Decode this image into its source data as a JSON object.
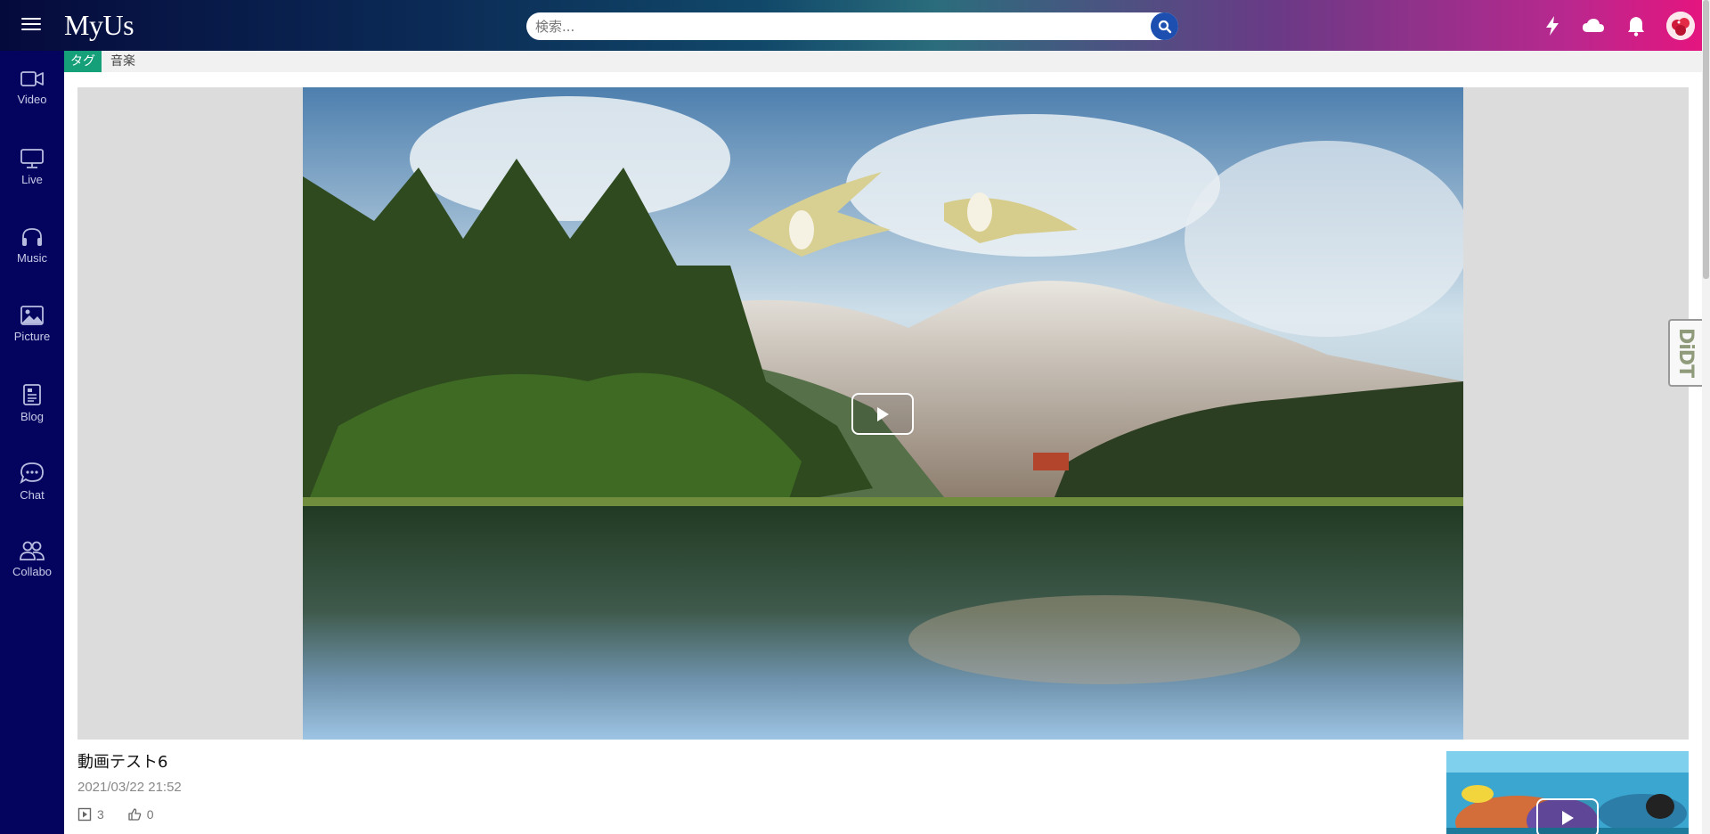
{
  "app": {
    "logo_text": "MyUs"
  },
  "header": {
    "search_placeholder": "検索...",
    "icons": [
      "lightning-icon",
      "cloud-icon",
      "bell-icon"
    ]
  },
  "sidebar": {
    "items": [
      {
        "label": "Video",
        "icon": "video-camera-icon"
      },
      {
        "label": "Live",
        "icon": "monitor-icon"
      },
      {
        "label": "Music",
        "icon": "headphones-icon"
      },
      {
        "label": "Picture",
        "icon": "image-icon"
      },
      {
        "label": "Blog",
        "icon": "document-icon"
      },
      {
        "label": "Chat",
        "icon": "chat-bubble-icon"
      },
      {
        "label": "Collabo",
        "icon": "users-icon"
      }
    ]
  },
  "tagbar": {
    "label": "タグ",
    "value": "音楽"
  },
  "video": {
    "title": "動画テスト6",
    "date": "2021/03/22 21:52",
    "play_count": "3",
    "like_count": "0"
  },
  "side_widget": {
    "text": "DiDT"
  },
  "colors": {
    "sidebar_bg": "#04045e",
    "tag_accent": "#15a07a",
    "search_button": "#1d4fb0"
  }
}
